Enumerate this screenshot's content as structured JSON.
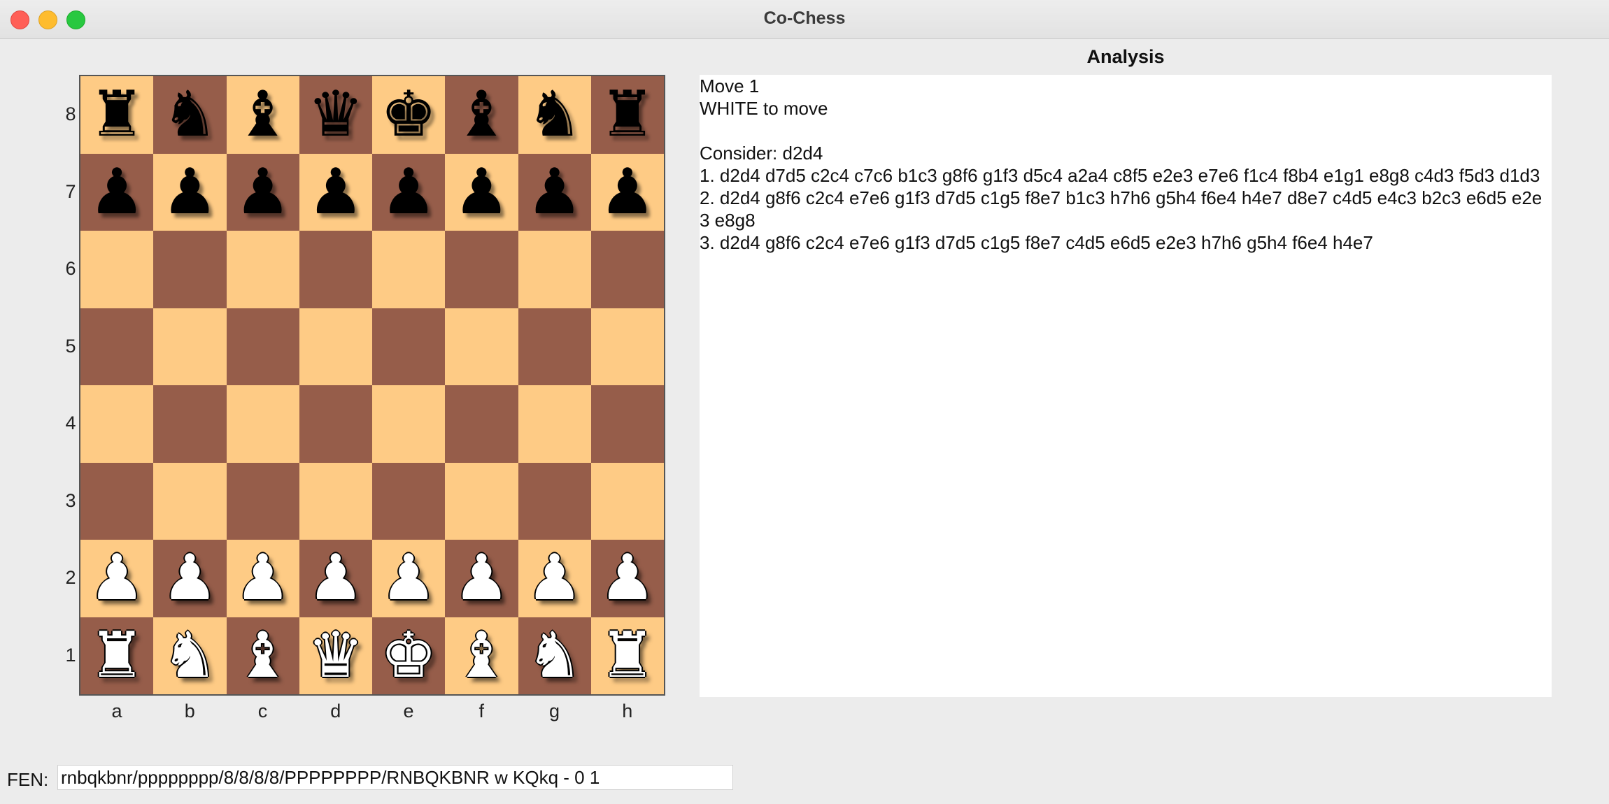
{
  "window": {
    "title": "Co-Chess"
  },
  "board": {
    "ranks": [
      "8",
      "7",
      "6",
      "5",
      "4",
      "3",
      "2",
      "1"
    ],
    "files": [
      "a",
      "b",
      "c",
      "d",
      "e",
      "f",
      "g",
      "h"
    ],
    "rows": [
      [
        "r",
        "n",
        "b",
        "q",
        "k",
        "b",
        "n",
        "r"
      ],
      [
        "p",
        "p",
        "p",
        "p",
        "p",
        "p",
        "p",
        "p"
      ],
      [
        "",
        "",
        "",
        "",
        "",
        "",
        "",
        ""
      ],
      [
        "",
        "",
        "",
        "",
        "",
        "",
        "",
        ""
      ],
      [
        "",
        "",
        "",
        "",
        "",
        "",
        "",
        ""
      ],
      [
        "",
        "",
        "",
        "",
        "",
        "",
        "",
        ""
      ],
      [
        "P",
        "P",
        "P",
        "P",
        "P",
        "P",
        "P",
        "P"
      ],
      [
        "R",
        "N",
        "B",
        "Q",
        "K",
        "B",
        "N",
        "R"
      ]
    ],
    "light_color": "#fecb85",
    "dark_color": "#965d4a"
  },
  "analysis": {
    "title": "Analysis",
    "lines": [
      "Move 1",
      "WHITE to move",
      "",
      "Consider: d2d4",
      "1. d2d4 d7d5 c2c4 c7c6 b1c3 g8f6 g1f3 d5c4 a2a4 c8f5 e2e3 e7e6 f1c4 f8b4 e1g1 e8g8 c4d3 f5d3 d1d3",
      "2. d2d4 g8f6 c2c4 e7e6 g1f3 d7d5 c1g5 f8e7 b1c3 h7h6 g5h4 f6e4 h4e7 d8e7 c4d5 e4c3 b2c3 e6d5 e2e3 e8g8",
      "3. d2d4 g8f6 c2c4 e7e6 g1f3 d7d5 c1g5 f8e7 c4d5 e6d5 e2e3 h7h6 g5h4 f6e4 h4e7"
    ]
  },
  "fen": {
    "label": "FEN:",
    "value": "rnbqkbnr/pppppppp/8/8/8/8/PPPPPPPP/RNBQKBNR w KQkq - 0 1"
  }
}
